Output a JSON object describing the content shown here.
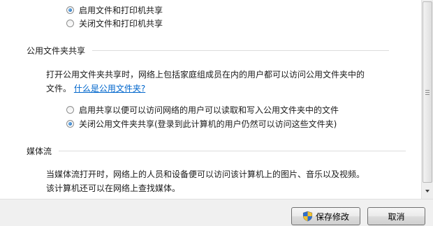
{
  "printer_sharing": {
    "options": [
      {
        "label": "启用文件和打印机共享",
        "checked": true
      },
      {
        "label": "关闭文件和打印机共享",
        "checked": false
      }
    ]
  },
  "public_folder_sharing": {
    "heading": "公用文件夹共享",
    "description_line1": "打开公用文件夹共享时，网络上包括家庭组成员在内的用户都可以访问公用文件夹中的",
    "description_line2_prefix": "文件。",
    "help_link": "什么是公用文件夹?",
    "options": [
      {
        "label": "启用共享以便可以访问网络的用户可以读取和写入公用文件夹中的文件",
        "checked": false
      },
      {
        "label": "关闭公用文件夹共享(登录到此计算机的用户仍然可以访问这些文件夹)",
        "checked": true
      }
    ]
  },
  "media_streaming": {
    "heading": "媒体流",
    "description_line1": "当媒体流打开时，网络上的人员和设备便可以访问该计算机上的图片、音乐以及视频。",
    "description_line2": "该计算机还可以在网络上查找媒体。"
  },
  "footer": {
    "save_label": "保存修改",
    "cancel_label": "取消"
  },
  "colors": {
    "link": "#0066cc",
    "footer_bg": "#f0f0f0"
  }
}
